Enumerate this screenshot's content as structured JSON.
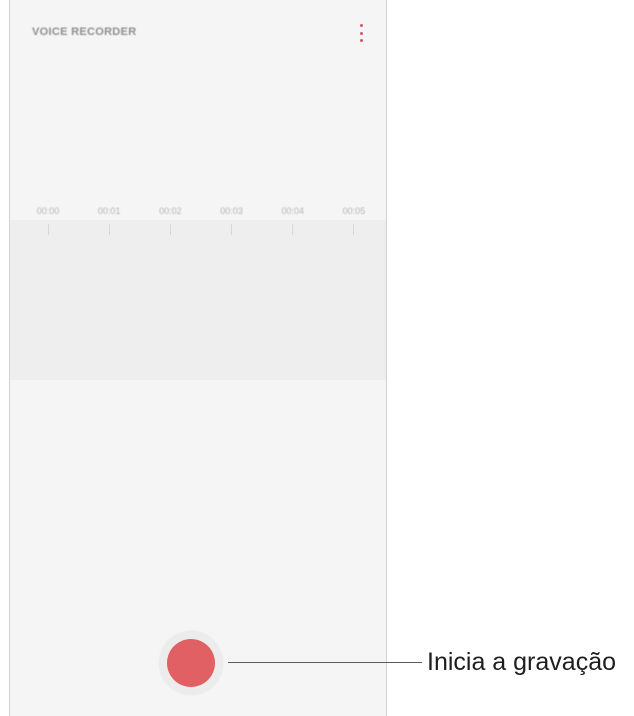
{
  "app": {
    "title": "VOICE RECORDER",
    "accent_color": "#d9546a",
    "record_color": "#e06063"
  },
  "header": {
    "menu_icon": "more-vertical-icon"
  },
  "timeline": {
    "ticks": [
      "00:00",
      "00:01",
      "00:02",
      "00:03",
      "00:04",
      "00:05"
    ]
  },
  "record_button": {
    "icon": "record-icon"
  },
  "callout": {
    "label": "Inicia a gravação"
  }
}
